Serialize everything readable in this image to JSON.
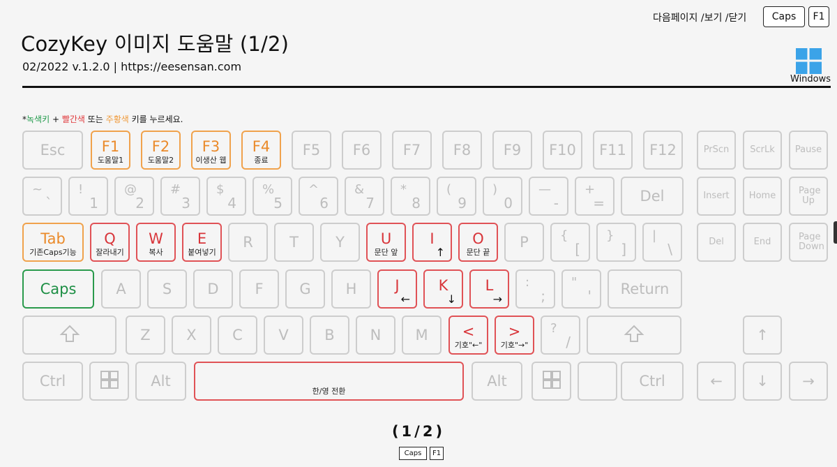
{
  "header": {
    "title": "CozyKey  이미지 도움말 (1/2)",
    "subtitle": "02/2022 v.1.2.0 | https://eesensan.com",
    "nav_text": "다음페이지 /보기 /닫기",
    "nav_key_caps": "Caps",
    "nav_key_f1": "F1",
    "os_label": "Windows"
  },
  "instruction": {
    "star": "*",
    "green_text": "녹색키",
    "plus": " + ",
    "red_text": "빨간색",
    "or": " 또는 ",
    "orange_text": "주황색",
    "rest": " 키를 누르세요."
  },
  "keyboard": {
    "row0": [
      {
        "label": "Esc"
      },
      {
        "label": "F1",
        "sub": "도움말1",
        "color": "orange"
      },
      {
        "label": "F2",
        "sub": "도움말2",
        "color": "orange"
      },
      {
        "label": "F3",
        "sub": "이생산 웹",
        "color": "orange"
      },
      {
        "label": "F4",
        "sub": "종료",
        "color": "orange"
      },
      {
        "label": "F5"
      },
      {
        "label": "F6"
      },
      {
        "label": "F7"
      },
      {
        "label": "F8"
      },
      {
        "label": "F9"
      },
      {
        "label": "F10"
      },
      {
        "label": "F11"
      },
      {
        "label": "F12"
      },
      {
        "label": "PrScn"
      },
      {
        "label": "ScrLk"
      },
      {
        "label": "Pause"
      }
    ],
    "row1": [
      {
        "top": "~",
        "bot": "`"
      },
      {
        "top": "!",
        "bot": "1"
      },
      {
        "top": "@",
        "bot": "2"
      },
      {
        "top": "#",
        "bot": "3"
      },
      {
        "top": "$",
        "bot": "4"
      },
      {
        "top": "%",
        "bot": "5"
      },
      {
        "top": "^",
        "bot": "6"
      },
      {
        "top": "&",
        "bot": "7"
      },
      {
        "top": "*",
        "bot": "8"
      },
      {
        "top": "(",
        "bot": "9"
      },
      {
        "top": ")",
        "bot": "0"
      },
      {
        "top": "—",
        "bot": "-"
      },
      {
        "top": "+",
        "bot": "="
      },
      {
        "label": "Del"
      },
      {
        "label": "Insert"
      },
      {
        "label": "Home"
      },
      {
        "label": "Page Up"
      }
    ],
    "row2": [
      {
        "label": "Tab",
        "sub": "기존Caps기능",
        "color": "orange"
      },
      {
        "label": "Q",
        "sub": "잘라내기",
        "color": "red"
      },
      {
        "label": "W",
        "sub": "복사",
        "color": "red"
      },
      {
        "label": "E",
        "sub": "붙여넣기",
        "color": "red"
      },
      {
        "label": "R"
      },
      {
        "label": "T"
      },
      {
        "label": "Y"
      },
      {
        "label": "U",
        "sub": "문단 앞",
        "color": "red"
      },
      {
        "label": "I",
        "arrow": "↑",
        "color": "red"
      },
      {
        "label": "O",
        "sub": "문단 끝",
        "color": "red"
      },
      {
        "label": "P"
      },
      {
        "top": "{",
        "bot": "["
      },
      {
        "top": "}",
        "bot": "]"
      },
      {
        "top": "|",
        "bot": "\\"
      },
      {
        "label": "Del"
      },
      {
        "label": "End"
      },
      {
        "label": "Page Down"
      }
    ],
    "row3": [
      {
        "label": "Caps",
        "color": "green"
      },
      {
        "label": "A"
      },
      {
        "label": "S"
      },
      {
        "label": "D"
      },
      {
        "label": "F"
      },
      {
        "label": "G"
      },
      {
        "label": "H"
      },
      {
        "label": "J",
        "arrow": "←",
        "color": "red"
      },
      {
        "label": "K",
        "arrow": "↓",
        "color": "red"
      },
      {
        "label": "L",
        "arrow": "→",
        "color": "red"
      },
      {
        "top": ":",
        "bot": ";"
      },
      {
        "top": "\"",
        "bot": "'"
      },
      {
        "label": "Return"
      }
    ],
    "row4": [
      {
        "icon": "shift-icon"
      },
      {
        "label": "Z"
      },
      {
        "label": "X"
      },
      {
        "label": "C"
      },
      {
        "label": "V"
      },
      {
        "label": "B"
      },
      {
        "label": "N"
      },
      {
        "label": "M"
      },
      {
        "label": "<",
        "sub": "기호\"←\"",
        "color": "red"
      },
      {
        "label": ">",
        "sub": "기호\"→\"",
        "color": "red"
      },
      {
        "top": "?",
        "bot": "/"
      },
      {
        "icon": "shift-icon"
      },
      {
        "label": "↑"
      }
    ],
    "row5": [
      {
        "label": "Ctrl"
      },
      {
        "icon": "windows-icon"
      },
      {
        "label": "Alt"
      },
      {
        "label": "",
        "sub": "한/영 전환",
        "color": "red"
      },
      {
        "label": "Alt"
      },
      {
        "icon": "windows-icon"
      },
      {
        "label": ""
      },
      {
        "label": "Ctrl"
      },
      {
        "label": "←"
      },
      {
        "label": "↓"
      },
      {
        "label": "→"
      }
    ]
  },
  "footer": {
    "pager": "(1/2)",
    "key_caps": "Caps",
    "key_f1": "F1"
  }
}
